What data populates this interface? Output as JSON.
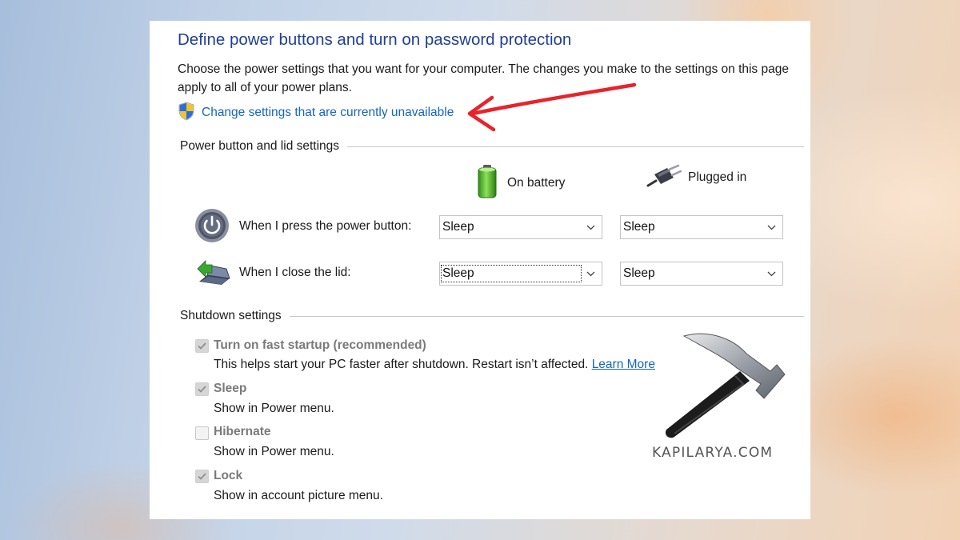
{
  "page": {
    "title": "Define power buttons and turn on password protection",
    "description": "Choose the power settings that you want for your computer. The changes you make to the settings on this page apply to all of your power plans.",
    "change_link": "Change settings that are currently unavailable"
  },
  "power_section": {
    "label": "Power button and lid settings",
    "columns": {
      "battery": "On battery",
      "plugged": "Plugged in"
    },
    "rows": [
      {
        "label": "When I press the power button:",
        "battery": "Sleep",
        "plugged": "Sleep",
        "icon": "power-button-icon"
      },
      {
        "label": "When I close the lid:",
        "battery": "Sleep",
        "plugged": "Sleep",
        "icon": "laptop-lid-icon"
      }
    ]
  },
  "shutdown_section": {
    "label": "Shutdown settings",
    "items": [
      {
        "title": "Turn on fast startup (recommended)",
        "desc": "This helps start your PC faster after shutdown. Restart isn’t affected.",
        "link": "Learn More",
        "checked": true
      },
      {
        "title": "Sleep",
        "desc": "Show in Power menu.",
        "checked": true
      },
      {
        "title": "Hibernate",
        "desc": "Show in Power menu.",
        "checked": false
      },
      {
        "title": "Lock",
        "desc": "Show in account picture menu.",
        "checked": true
      }
    ]
  },
  "watermark": {
    "text": "KAPILARYA.COM"
  },
  "colors": {
    "title": "#1f3f99",
    "link": "#1565c0",
    "annotation_arrow": "#e8232a"
  }
}
